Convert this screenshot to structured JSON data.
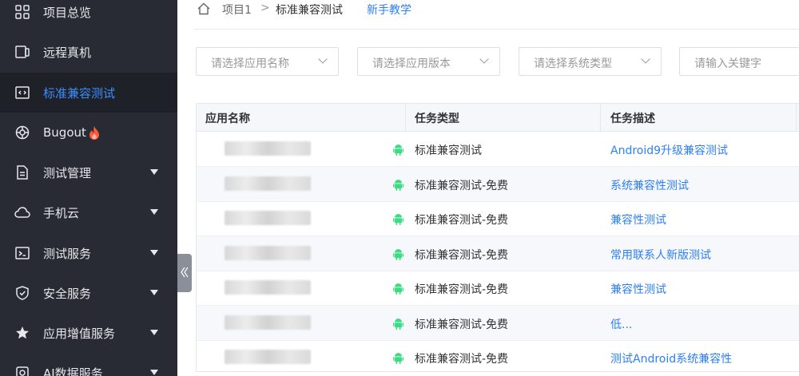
{
  "sidebar": {
    "items": [
      {
        "label": "项目总览",
        "icon": "grid-icon",
        "arrow": false,
        "active": false
      },
      {
        "label": "远程真机",
        "icon": "device-icon",
        "arrow": false,
        "active": false
      },
      {
        "label": "标准兼容测试",
        "icon": "code-window-icon",
        "arrow": false,
        "active": true
      },
      {
        "label": "Bugout",
        "icon": "bug-icon",
        "arrow": false,
        "active": false
      },
      {
        "label": "测试管理",
        "icon": "document-icon",
        "arrow": true,
        "active": false
      },
      {
        "label": "手机云",
        "icon": "cloud-icon",
        "arrow": true,
        "active": false
      },
      {
        "label": "测试服务",
        "icon": "terminal-icon",
        "arrow": true,
        "active": false
      },
      {
        "label": "安全服务",
        "icon": "shield-icon",
        "arrow": true,
        "active": false
      },
      {
        "label": "应用增值服务",
        "icon": "star-icon",
        "arrow": true,
        "active": false
      },
      {
        "label": "AI数据服务",
        "icon": "ai-icon",
        "arrow": true,
        "active": false
      }
    ]
  },
  "breadcrumb": {
    "project": "项目1",
    "separator": ">",
    "current": "标准兼容测试",
    "link": "新手教学"
  },
  "filters": {
    "app_name": "请选择应用名称",
    "app_version": "请选择应用版本",
    "system_type": "请选择系统类型",
    "keyword": "请输入关键字"
  },
  "table": {
    "headers": [
      "应用名称",
      "任务类型",
      "任务描述"
    ],
    "rows": [
      {
        "type": "标准兼容测试",
        "desc": "Android9升级兼容测试"
      },
      {
        "type": "标准兼容测试-免费",
        "desc": "系统兼容性测试"
      },
      {
        "type": "标准兼容测试-免费",
        "desc": "兼容性测试"
      },
      {
        "type": "标准兼容测试-免费",
        "desc": "常用联系人新版测试"
      },
      {
        "type": "标准兼容测试-免费",
        "desc": "兼容性测试"
      },
      {
        "type": "标准兼容测试-免费",
        "desc": "低..."
      },
      {
        "type": "标准兼容测试-免费",
        "desc": "测试Android系统兼容性"
      }
    ]
  },
  "colors": {
    "sidebar_bg": "#282b33",
    "active_item_bg": "#1e2128",
    "accent": "#2d7ff9",
    "android_green": "#3ddc84",
    "flame": "#ff5a3c"
  }
}
